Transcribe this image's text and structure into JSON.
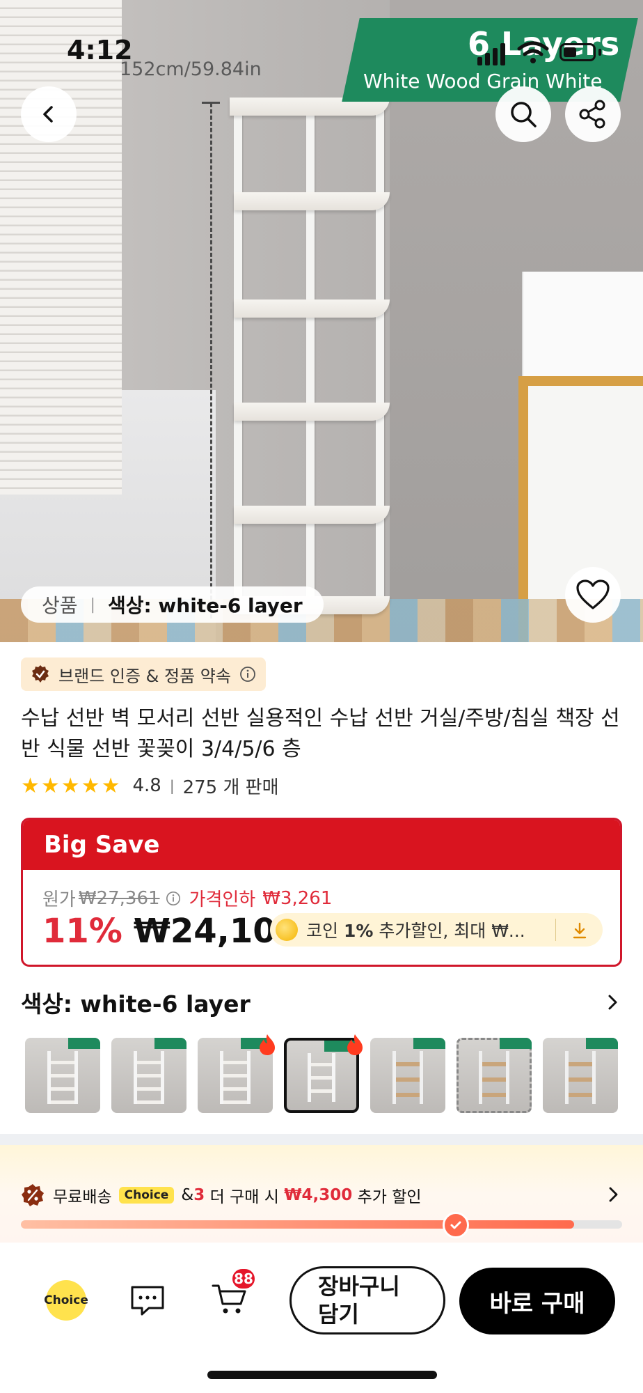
{
  "status_bar": {
    "time": "4:12"
  },
  "hero": {
    "banner_title": "6 Layers",
    "banner_subtitle": "White Wood Grain White",
    "dimension": "152cm/59.84in"
  },
  "variant_pill": {
    "category": "상품",
    "selected": "색상: white-6 layer"
  },
  "brand_badge": {
    "label": "브랜드 인증 & 정품 약속"
  },
  "product": {
    "title": "수납 선반 벽 모서리 선반 실용적인 수납 선반 거실/주방/침실 책장 선반 식물 선반 꽃꽂이 3/4/5/6 층",
    "stars": "★★★★★",
    "rating": "4.8",
    "sold": "275 개 판매"
  },
  "price_box": {
    "header": "Big Save",
    "original_label": "원가",
    "original_price": "₩27,361",
    "price_drop_label": "가격인하",
    "price_drop_value": "₩3,261",
    "discount_pct": "11%",
    "price": "₩24,100",
    "coin_prefix": "코인 ",
    "coin_bold": "1%",
    "coin_suffix": " 추가할인, 최대 ₩..."
  },
  "color_selector": {
    "label": "색상: white-6 layer",
    "thumbnails": [
      {
        "style": "white",
        "selected": false,
        "hot": false
      },
      {
        "style": "white",
        "selected": false,
        "hot": false
      },
      {
        "style": "white",
        "selected": false,
        "hot": true
      },
      {
        "style": "white",
        "selected": true,
        "hot": true
      },
      {
        "style": "wood",
        "selected": false,
        "hot": false
      },
      {
        "style": "wood",
        "selected": false,
        "hot": false
      },
      {
        "style": "wood",
        "selected": false,
        "hot": false
      }
    ]
  },
  "shipping": {
    "free_label": "무료배송",
    "choice_chip": "Choice",
    "amp": "&",
    "count": "3",
    "more_text": " 더 구매 시 ",
    "discount": "₩4,300",
    "suffix": " 추가 할인",
    "progress": 0.92
  },
  "bottom_bar": {
    "choice_label": "Choice",
    "cart_badge": "88",
    "add_to_cart": "장바구니 담기",
    "buy_now": "바로 구매"
  },
  "colors": {
    "accent_red": "#d9141f",
    "price_red": "#e02b3a",
    "banner_green": "#1e8a5d",
    "choice_yellow": "#ffe24d"
  }
}
